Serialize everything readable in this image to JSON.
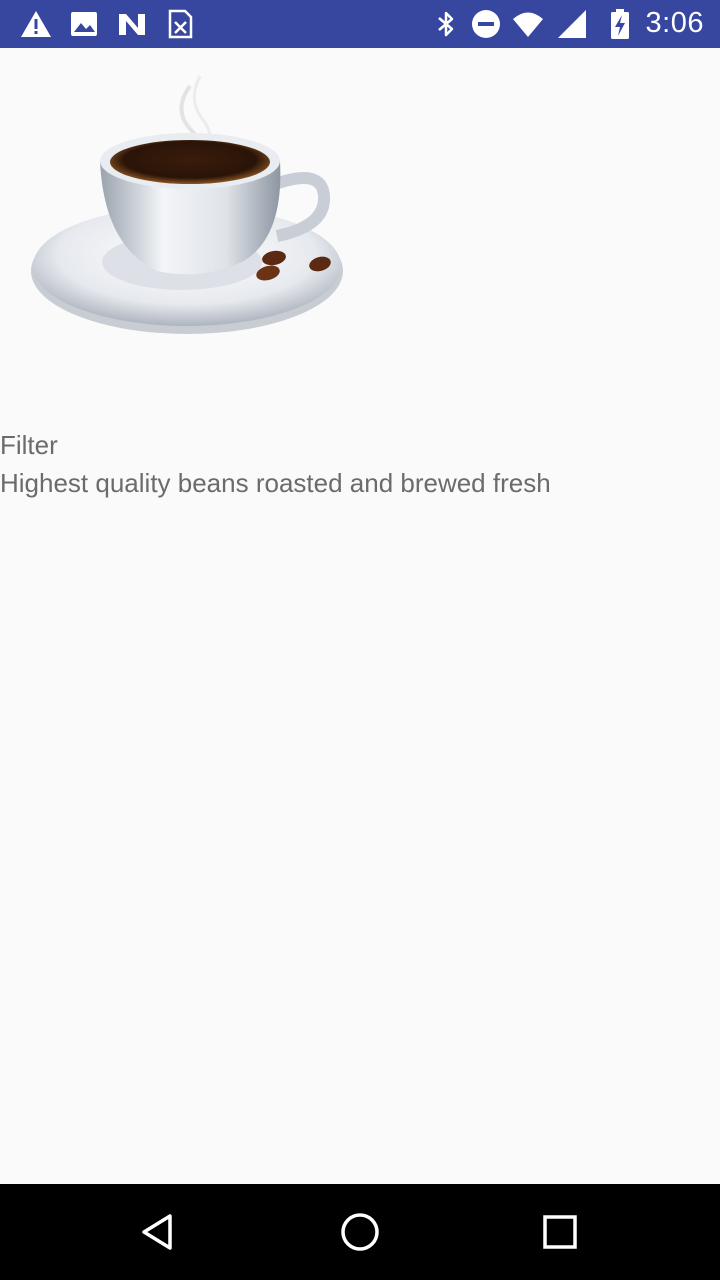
{
  "status_bar": {
    "time": "3:06",
    "left_icons": [
      "warning-icon",
      "image-icon",
      "n-logo-icon",
      "sim-card-icon"
    ],
    "right_icons": [
      "bluetooth-icon",
      "do-not-disturb-icon",
      "wifi-icon",
      "battery-charging-icon"
    ],
    "background": "#3747a0"
  },
  "product": {
    "image": "coffee-cup-image",
    "title": "Filter",
    "description": "Highest quality beans roasted and brewed fresh"
  },
  "nav_bar": {
    "buttons": [
      "back-icon",
      "home-icon",
      "recents-icon"
    ]
  }
}
